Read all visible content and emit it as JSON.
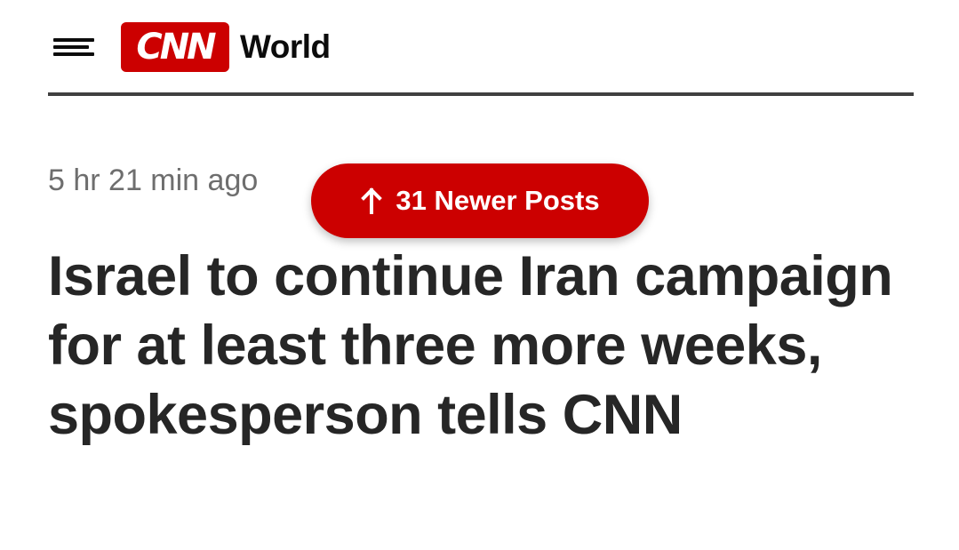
{
  "header": {
    "menu_icon": "hamburger-menu-icon",
    "logo_text": "CNN",
    "section": "World"
  },
  "post": {
    "timestamp": "5 hr 21 min ago",
    "newer_posts_label": "31 Newer Posts",
    "newer_posts_icon": "arrow-up-icon",
    "headline": "Israel to continue Iran campaign for at least three more weeks, spokesperson tells CNN"
  },
  "colors": {
    "brand_red": "#cc0000",
    "text_dark": "#262626",
    "timestamp_gray": "#6e6e6e",
    "divider": "#404040"
  }
}
